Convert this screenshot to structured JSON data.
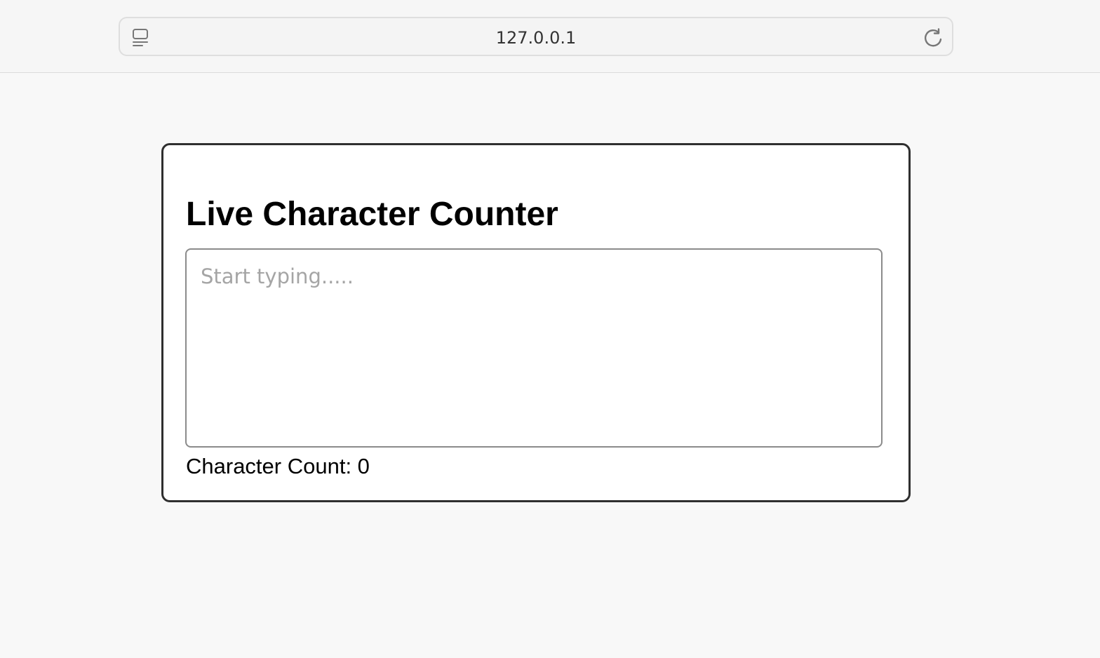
{
  "browser": {
    "url": "127.0.0.1",
    "page_icon": "reader-list-icon",
    "reload_icon": "reload-icon"
  },
  "main": {
    "title": "Live Character Counter",
    "textarea": {
      "placeholder": "Start typing.....",
      "value": ""
    },
    "counter": {
      "label": "Character Count: ",
      "value": "0"
    }
  },
  "colors": {
    "page_background": "#f8f8f8",
    "card_border": "#2f2f2f",
    "textarea_border": "#8b8b8b",
    "placeholder": "#a5a5a5"
  }
}
